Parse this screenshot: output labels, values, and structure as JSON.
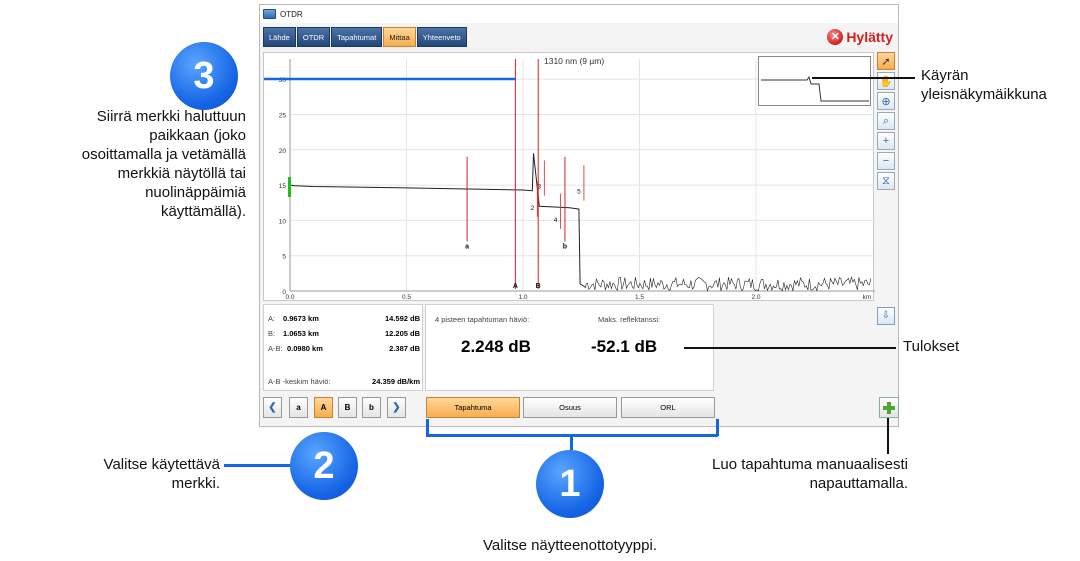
{
  "window": {
    "title": "OTDR"
  },
  "tabs": [
    {
      "label": "Lähde",
      "active": false
    },
    {
      "label": "OTDR",
      "active": false
    },
    {
      "label": "Tapahtumat",
      "active": false
    },
    {
      "label": "Mittaa",
      "active": true
    },
    {
      "label": "Yhteenveto",
      "active": false
    }
  ],
  "status": {
    "label": "Hylätty",
    "color": "#d11f1f"
  },
  "graph": {
    "wavelength": "1310 nm (9 µm)",
    "y_ticks": [
      "0",
      "5",
      "10",
      "15",
      "20",
      "25",
      "30"
    ],
    "x_ticks": [
      "0.0",
      "0.5",
      "1.0",
      "1.5",
      "2.0",
      "km"
    ],
    "marker_labels": [
      "A",
      "B"
    ],
    "event_labels": [
      "a",
      "b",
      "2",
      "3",
      "4",
      "5"
    ]
  },
  "chart_data": {
    "type": "line",
    "xlabel": "km",
    "ylabel": "",
    "xlim": [
      0,
      2.5
    ],
    "ylim": [
      0,
      32
    ],
    "series": [
      {
        "x": [
          0.0,
          0.02,
          0.1,
          0.5,
          1.0,
          1.04,
          1.045,
          1.07,
          1.2,
          1.24,
          1.245,
          1.27
        ],
        "y": [
          15.0,
          14.9,
          14.8,
          14.6,
          14.3,
          14.2,
          19.5,
          12.0,
          11.8,
          11.6,
          1.0,
          0.5
        ]
      }
    ],
    "markers": [
      {
        "name": "A",
        "x": 0.9673
      },
      {
        "name": "B",
        "x": 1.0653
      },
      {
        "name": "a",
        "x": 0.76
      },
      {
        "name": "b",
        "x": 1.18
      }
    ]
  },
  "tools": [
    {
      "icon": "pointer-icon",
      "selected": true
    },
    {
      "icon": "hand-icon",
      "selected": false
    },
    {
      "icon": "zoom-fit-icon",
      "selected": false
    },
    {
      "icon": "zoom-icon",
      "selected": false
    },
    {
      "icon": "zoom-in-icon",
      "selected": false
    },
    {
      "icon": "zoom-out-icon",
      "selected": false
    },
    {
      "icon": "reset-zoom-icon",
      "selected": false
    }
  ],
  "markers": {
    "rows": [
      {
        "label": "A:",
        "km": "0.9673 km",
        "db": "14.592 dB"
      },
      {
        "label": "B:",
        "km": "1.0653 km",
        "db": "12.205 dB"
      },
      {
        "label": "A-B:",
        "km": "0.0980 km",
        "db": "2.387 dB"
      }
    ],
    "avg_label": "A-B -keskim häviö:",
    "avg_value": "24.359 dB/km"
  },
  "results": {
    "loss_label": "4 pisteen tapahtuman häviö:",
    "loss_value": "2.248 dB",
    "refl_label": "Maks. reflektanssi:",
    "refl_value": "-52.1 dB"
  },
  "marker_buttons": [
    {
      "label": "a",
      "selected": false
    },
    {
      "label": "A",
      "selected": true
    },
    {
      "label": "B",
      "selected": false
    },
    {
      "label": "b",
      "selected": false
    }
  ],
  "type_buttons": [
    {
      "label": "Tapahtuma",
      "selected": true
    },
    {
      "label": "Osuus",
      "selected": false
    },
    {
      "label": "ORL",
      "selected": false
    }
  ],
  "annotations": {
    "n1": "1",
    "n2": "2",
    "n3": "3",
    "callout1": "Valitse näytteenottotyyppi.",
    "callout2_line1": "Valitse käytettävä",
    "callout2_line2": "merkki.",
    "callout3_line1": "Siirrä merkki haluttuun",
    "callout3_line2": "paikkaan (joko",
    "callout3_line3": "osoittamalla ja vetämällä",
    "callout3_line4": "merkkiä näytöllä tai",
    "callout3_line5": "nuolinäppäimiä",
    "callout3_line6": "käyttämällä).",
    "overview_line1": "Käyrän",
    "overview_line2": "yleisnäkymäikkuna",
    "results": "Tulokset",
    "add_line1": "Luo tapahtuma manuaalisesti",
    "add_line2": "napauttamalla."
  }
}
